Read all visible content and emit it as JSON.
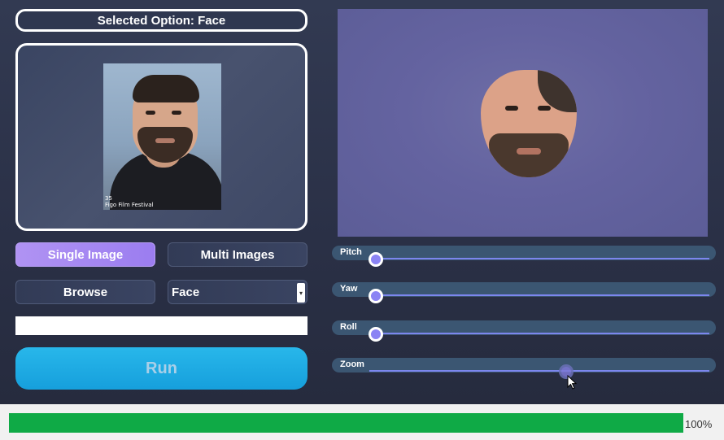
{
  "header": {
    "selected_option": "Selected Option: Face"
  },
  "preview": {
    "caption_line1": "35",
    "caption_line2": "Figo Film Festival"
  },
  "buttons": {
    "single_image": "Single Image",
    "multi_images": "Multi Images",
    "browse": "Browse",
    "run": "Run"
  },
  "mode_select": {
    "selected": "Face"
  },
  "path_input": {
    "value": ""
  },
  "sliders": [
    {
      "label": "Pitch",
      "value_fraction": 0.02
    },
    {
      "label": "Yaw",
      "value_fraction": 0.02
    },
    {
      "label": "Roll",
      "value_fraction": 0.02
    },
    {
      "label": "Zoom",
      "value_fraction": 0.58
    }
  ],
  "progress": {
    "percent": 100,
    "text": "100%"
  },
  "colors": {
    "accent_purple": "#9b7df0",
    "run_blue": "#169fdc",
    "progress_green": "#0faa46"
  }
}
